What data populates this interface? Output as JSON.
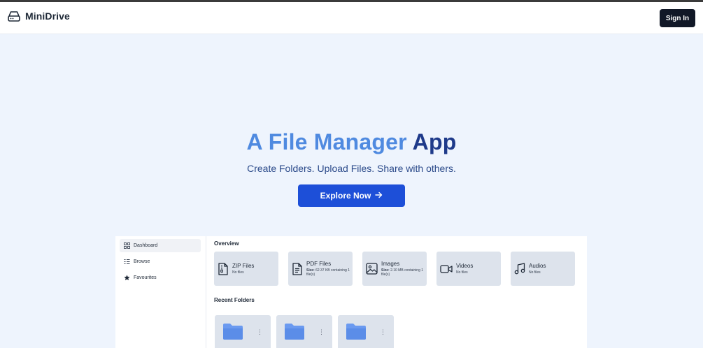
{
  "header": {
    "brand": "MiniDrive",
    "sign_in_label": "Sign In"
  },
  "hero": {
    "title_part1": "A File Manager",
    "title_part2": "App",
    "subtitle": "Create Folders. Upload Files. Share with others.",
    "cta_label": "Explore Now"
  },
  "preview": {
    "sidebar": {
      "items": [
        {
          "label": "Dashboard",
          "icon": "grid-icon",
          "active": true
        },
        {
          "label": "Browse",
          "icon": "list-icon",
          "active": false
        },
        {
          "label": "Favourites",
          "icon": "star-icon",
          "active": false
        }
      ]
    },
    "overview": {
      "title": "Overview",
      "cards": [
        {
          "title": "ZIP Files",
          "sub": "No files",
          "icon": "zip-file-icon"
        },
        {
          "title": "PDF Files",
          "sub_label": "Size:",
          "sub": "62.37 KB containing 1 file(s)",
          "icon": "pdf-file-icon"
        },
        {
          "title": "Images",
          "sub_label": "Size:",
          "sub": "2.10 MB containing 1 file(s)",
          "icon": "image-icon"
        },
        {
          "title": "Videos",
          "sub": "No files",
          "icon": "video-icon"
        },
        {
          "title": "Audios",
          "sub": "No files",
          "icon": "music-icon"
        }
      ]
    },
    "recent": {
      "title": "Recent Folders",
      "folder_count": 3
    }
  },
  "colors": {
    "page_bg": "#eef4fd",
    "title_light": "#4f8ae0",
    "title_dark": "#1e3a8a",
    "cta": "#1d4fd8",
    "sign_in": "#111827",
    "folder": "#6b9af0"
  }
}
